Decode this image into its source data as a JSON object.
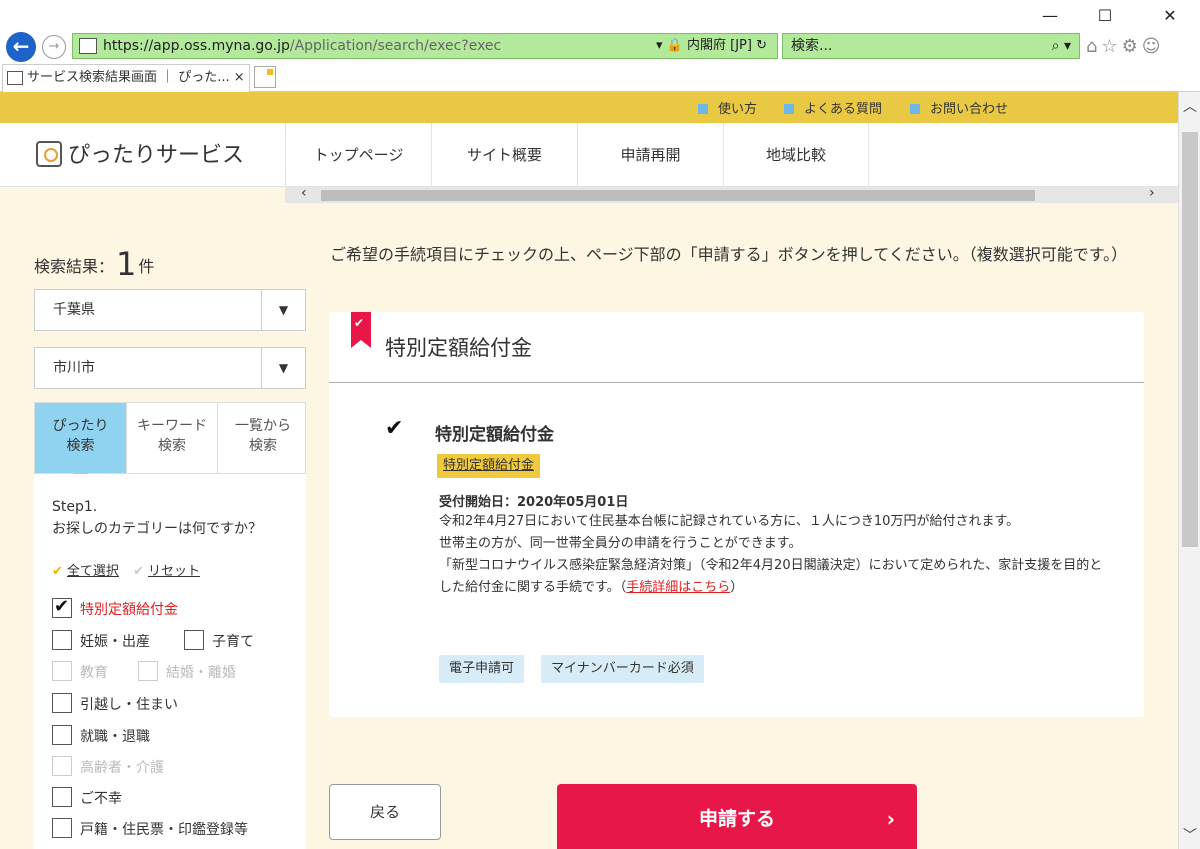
{
  "browser": {
    "window_controls": [
      "—",
      "☐",
      "✕"
    ],
    "url_host": "https://app.oss.myna.go.jp",
    "url_path": "/Application/search/exec?exec",
    "url_right": "▾ 🔒 内閣府 [JP] ↻",
    "search_placeholder": "検索...",
    "search_icon": "⌕ ▾",
    "tool_icons": "⌂☆⚙☺",
    "tab_title": "サービス検索結果画面 ｜ ぴった... ×"
  },
  "util_links": [
    "使い方",
    "よくある質問",
    "お問い合わせ"
  ],
  "header": {
    "logo": "ぴったりサービス",
    "nav": [
      "トップページ",
      "サイト概要",
      "申請再開",
      "地域比較"
    ]
  },
  "scroll_glyphs": {
    "up": "︿",
    "down": "﹀",
    "left": "‹",
    "right": "›"
  },
  "sidebar": {
    "result_label": "検索結果：",
    "result_count": "1",
    "result_unit": "件",
    "prefecture": "千葉県",
    "city": "市川市",
    "select_arrow": "▼",
    "search_tabs": [
      {
        "label": "ぴったり\n検索",
        "active": true
      },
      {
        "label": "キーワード\n検索",
        "active": false
      },
      {
        "label": "一覧から\n検索",
        "active": false
      }
    ],
    "step_title": "Step1.\nお探しのカテゴリーは何ですか？",
    "select_all": "全て選択",
    "reset": "リセット",
    "check_glyph": "✔",
    "categories": [
      {
        "label": "特別定額給付金",
        "checked": true,
        "disabled": false
      },
      {
        "label": "妊娠・出産",
        "checked": false,
        "disabled": false
      },
      {
        "label": "子育て",
        "checked": false,
        "disabled": false
      },
      {
        "label": "教育",
        "checked": false,
        "disabled": true
      },
      {
        "label": "結婚・離婚",
        "checked": false,
        "disabled": true
      },
      {
        "label": "引越し・住まい",
        "checked": false,
        "disabled": false
      },
      {
        "label": "就職・退職",
        "checked": false,
        "disabled": false
      },
      {
        "label": "高齢者・介護",
        "checked": false,
        "disabled": true
      },
      {
        "label": "ご不幸",
        "checked": false,
        "disabled": false
      },
      {
        "label": "戸籍・住民票・印鑑登録等",
        "checked": false,
        "disabled": false
      }
    ]
  },
  "main": {
    "instruction": "ご希望の手続項目にチェックの上、ページ下部の「申請する」ボタンを押してください。（複数選択可能です。）",
    "card_title": "特別定額給付金",
    "proc_check": "✔",
    "proc_title": "特別定額給付金",
    "proc_tag": "特別定額給付金",
    "proc_date": "受付開始日：2020年05月01日",
    "proc_desc_1": "令和2年4月27日において住民基本台帳に記録されている方に、１人につき10万円が給付されます。",
    "proc_desc_2": "世帯主の方が、同一世帯全員分の申請を行うことができます。",
    "proc_desc_3": "「新型コロナウイルス感染症緊急経済対策」（令和2年4月20日閣議決定）において定められた、家計支援を目的とした給付金に関する手続です。（",
    "proc_detail_link": "手続詳細はこちら",
    "proc_desc_close": "）",
    "badges": [
      "電子申請可",
      "マイナンバーカード必須"
    ],
    "back_label": "戻る",
    "apply_label": "申請する",
    "apply_chevron": "›"
  },
  "colors": {
    "accent_red": "#e8174a",
    "util_yellow": "#e9c844",
    "tab_blue": "#8fd3f1",
    "address_green": "#b2e99a",
    "page_bg": "#fdf6e3"
  }
}
